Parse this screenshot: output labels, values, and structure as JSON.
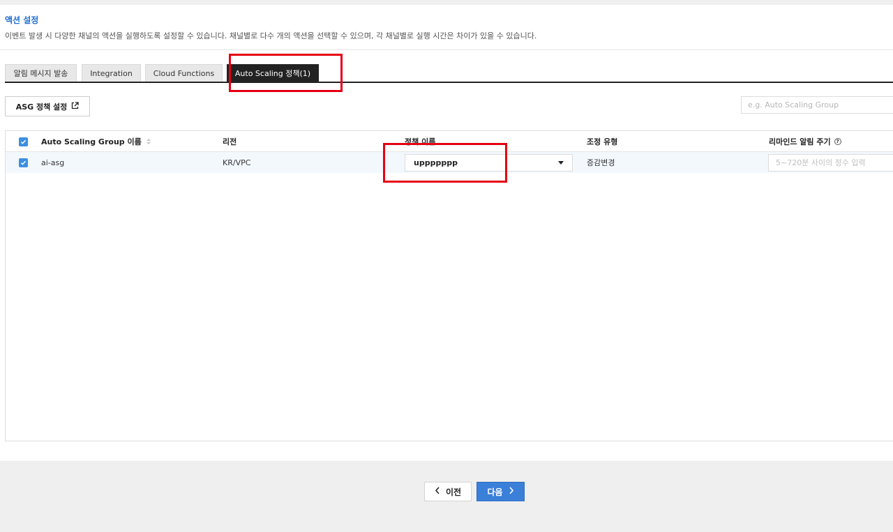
{
  "section": {
    "title": "액션 설정",
    "description": "이벤트 발생 시 다양한 채널의 액션을 실행하도록 설정할 수 있습니다. 채널별로 다수 개의 액션을 선택할 수 있으며, 각 채널별로 실행 시간은 차이가 있을 수 있습니다."
  },
  "tabs": [
    {
      "label": "알림 메시지 발송",
      "active": false
    },
    {
      "label": "Integration",
      "active": false
    },
    {
      "label": "Cloud Functions",
      "active": false
    },
    {
      "label": "Auto Scaling 정책(1)",
      "active": true
    }
  ],
  "toolbar": {
    "asg_button_label": "ASG 정책 설정",
    "search_placeholder": "e.g. Auto Scaling Group"
  },
  "table": {
    "headers": {
      "name": "Auto Scaling Group 이름",
      "region": "리전",
      "policy": "정책 이름",
      "adjust_type": "조정 유형",
      "reminder": "리마인드 알림 주기"
    },
    "rows": [
      {
        "checked": true,
        "name": "ai-asg",
        "region": "KR/VPC",
        "policy": "uppppppp",
        "adjust_type": "증감변경",
        "reminder_placeholder": "5~720분 사이의 정수 입력"
      }
    ]
  },
  "footer": {
    "prev_label": "이전",
    "next_label": "다음"
  },
  "colors": {
    "accent": "#3a7fd8",
    "title": "#1f6fd0",
    "highlight": "#e60012",
    "active_tab": "#222222"
  }
}
